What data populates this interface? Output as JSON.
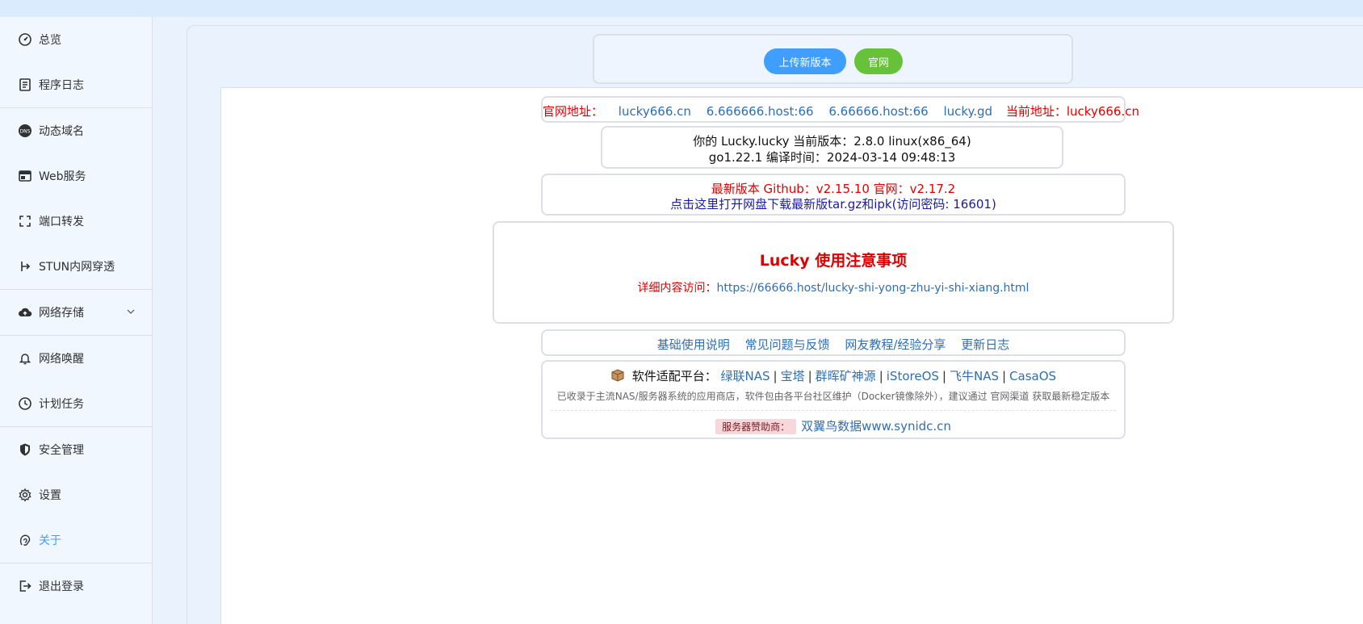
{
  "sidebar": {
    "items": [
      {
        "label": "总览",
        "icon": "dashboard-icon"
      },
      {
        "label": "程序日志",
        "icon": "log-icon"
      },
      {
        "label": "动态域名",
        "icon": "dns-icon"
      },
      {
        "label": "Web服务",
        "icon": "web-icon"
      },
      {
        "label": "端口转发",
        "icon": "port-forward-icon"
      },
      {
        "label": "STUN内网穿透",
        "icon": "stun-icon"
      },
      {
        "label": "网络存储",
        "icon": "cloud-storage-icon"
      },
      {
        "label": "网络唤醒",
        "icon": "bell-icon"
      },
      {
        "label": "计划任务",
        "icon": "clock-icon"
      },
      {
        "label": "安全管理",
        "icon": "shield-icon"
      },
      {
        "label": "设置",
        "icon": "gear-icon"
      },
      {
        "label": "关于",
        "icon": "about-icon"
      },
      {
        "label": "退出登录",
        "icon": "logout-icon"
      }
    ],
    "active_color": "#409eff"
  },
  "toolbar": {
    "upload_label": "上传新版本",
    "site_label": "官网"
  },
  "sites": {
    "label": "官网地址：",
    "links": [
      "lucky666.cn",
      "6.666666.host:66",
      "6.66666.host:66",
      "lucky.gd"
    ],
    "current_label": "当前地址：",
    "current_value": "lucky666.cn"
  },
  "version": {
    "line1": "你的 Lucky.lucky   当前版本：2.8.0 linux(x86_64)",
    "line2": "go1.22.1   编译时间：2024-03-14 09:48:13"
  },
  "latest": {
    "line1": "最新版本    Github：v2.15.10    官网：v2.17.2",
    "line2": "点击这里打开网盘下载最新版tar.gz和ipk(访问密码: 16601)"
  },
  "notice": {
    "title": "Lucky 使用注意事项",
    "detail_label": "详细内容访问：",
    "detail_link": "https://66666.host/lucky-shi-yong-zhu-yi-shi-xiang.html"
  },
  "docs": {
    "links": [
      "基础使用说明",
      "常见问题与反馈",
      "网友教程/经验分享",
      "更新日志"
    ]
  },
  "platforms": {
    "label": "软件适配平台：",
    "items": [
      "绿联NAS",
      "宝塔",
      "群晖矿神源",
      "iStoreOS",
      "飞牛NAS",
      "CasaOS"
    ],
    "separator": "|",
    "note": "已收录于主流NAS/服务器系统的应用商店，软件包由各平台社区维护（Docker镜像除外），建议通过 官网渠道 获取最新稳定版本",
    "sponsor_label": "服务器赞助商：",
    "sponsor_value": "双翼鸟数据www.synidc.cn"
  }
}
